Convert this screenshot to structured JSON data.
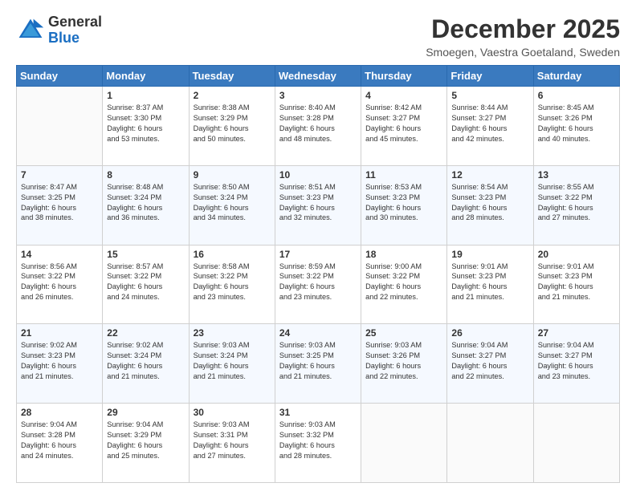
{
  "header": {
    "logo_line1": "General",
    "logo_line2": "Blue",
    "title": "December 2025",
    "subtitle": "Smoegen, Vaestra Goetaland, Sweden"
  },
  "days_of_week": [
    "Sunday",
    "Monday",
    "Tuesday",
    "Wednesday",
    "Thursday",
    "Friday",
    "Saturday"
  ],
  "weeks": [
    [
      {
        "day": "",
        "info": ""
      },
      {
        "day": "1",
        "info": "Sunrise: 8:37 AM\nSunset: 3:30 PM\nDaylight: 6 hours\nand 53 minutes."
      },
      {
        "day": "2",
        "info": "Sunrise: 8:38 AM\nSunset: 3:29 PM\nDaylight: 6 hours\nand 50 minutes."
      },
      {
        "day": "3",
        "info": "Sunrise: 8:40 AM\nSunset: 3:28 PM\nDaylight: 6 hours\nand 48 minutes."
      },
      {
        "day": "4",
        "info": "Sunrise: 8:42 AM\nSunset: 3:27 PM\nDaylight: 6 hours\nand 45 minutes."
      },
      {
        "day": "5",
        "info": "Sunrise: 8:44 AM\nSunset: 3:27 PM\nDaylight: 6 hours\nand 42 minutes."
      },
      {
        "day": "6",
        "info": "Sunrise: 8:45 AM\nSunset: 3:26 PM\nDaylight: 6 hours\nand 40 minutes."
      }
    ],
    [
      {
        "day": "7",
        "info": "Sunrise: 8:47 AM\nSunset: 3:25 PM\nDaylight: 6 hours\nand 38 minutes."
      },
      {
        "day": "8",
        "info": "Sunrise: 8:48 AM\nSunset: 3:24 PM\nDaylight: 6 hours\nand 36 minutes."
      },
      {
        "day": "9",
        "info": "Sunrise: 8:50 AM\nSunset: 3:24 PM\nDaylight: 6 hours\nand 34 minutes."
      },
      {
        "day": "10",
        "info": "Sunrise: 8:51 AM\nSunset: 3:23 PM\nDaylight: 6 hours\nand 32 minutes."
      },
      {
        "day": "11",
        "info": "Sunrise: 8:53 AM\nSunset: 3:23 PM\nDaylight: 6 hours\nand 30 minutes."
      },
      {
        "day": "12",
        "info": "Sunrise: 8:54 AM\nSunset: 3:23 PM\nDaylight: 6 hours\nand 28 minutes."
      },
      {
        "day": "13",
        "info": "Sunrise: 8:55 AM\nSunset: 3:22 PM\nDaylight: 6 hours\nand 27 minutes."
      }
    ],
    [
      {
        "day": "14",
        "info": "Sunrise: 8:56 AM\nSunset: 3:22 PM\nDaylight: 6 hours\nand 26 minutes."
      },
      {
        "day": "15",
        "info": "Sunrise: 8:57 AM\nSunset: 3:22 PM\nDaylight: 6 hours\nand 24 minutes."
      },
      {
        "day": "16",
        "info": "Sunrise: 8:58 AM\nSunset: 3:22 PM\nDaylight: 6 hours\nand 23 minutes."
      },
      {
        "day": "17",
        "info": "Sunrise: 8:59 AM\nSunset: 3:22 PM\nDaylight: 6 hours\nand 23 minutes."
      },
      {
        "day": "18",
        "info": "Sunrise: 9:00 AM\nSunset: 3:22 PM\nDaylight: 6 hours\nand 22 minutes."
      },
      {
        "day": "19",
        "info": "Sunrise: 9:01 AM\nSunset: 3:23 PM\nDaylight: 6 hours\nand 21 minutes."
      },
      {
        "day": "20",
        "info": "Sunrise: 9:01 AM\nSunset: 3:23 PM\nDaylight: 6 hours\nand 21 minutes."
      }
    ],
    [
      {
        "day": "21",
        "info": "Sunrise: 9:02 AM\nSunset: 3:23 PM\nDaylight: 6 hours\nand 21 minutes."
      },
      {
        "day": "22",
        "info": "Sunrise: 9:02 AM\nSunset: 3:24 PM\nDaylight: 6 hours\nand 21 minutes."
      },
      {
        "day": "23",
        "info": "Sunrise: 9:03 AM\nSunset: 3:24 PM\nDaylight: 6 hours\nand 21 minutes."
      },
      {
        "day": "24",
        "info": "Sunrise: 9:03 AM\nSunset: 3:25 PM\nDaylight: 6 hours\nand 21 minutes."
      },
      {
        "day": "25",
        "info": "Sunrise: 9:03 AM\nSunset: 3:26 PM\nDaylight: 6 hours\nand 22 minutes."
      },
      {
        "day": "26",
        "info": "Sunrise: 9:04 AM\nSunset: 3:27 PM\nDaylight: 6 hours\nand 22 minutes."
      },
      {
        "day": "27",
        "info": "Sunrise: 9:04 AM\nSunset: 3:27 PM\nDaylight: 6 hours\nand 23 minutes."
      }
    ],
    [
      {
        "day": "28",
        "info": "Sunrise: 9:04 AM\nSunset: 3:28 PM\nDaylight: 6 hours\nand 24 minutes."
      },
      {
        "day": "29",
        "info": "Sunrise: 9:04 AM\nSunset: 3:29 PM\nDaylight: 6 hours\nand 25 minutes."
      },
      {
        "day": "30",
        "info": "Sunrise: 9:03 AM\nSunset: 3:31 PM\nDaylight: 6 hours\nand 27 minutes."
      },
      {
        "day": "31",
        "info": "Sunrise: 9:03 AM\nSunset: 3:32 PM\nDaylight: 6 hours\nand 28 minutes."
      },
      {
        "day": "",
        "info": ""
      },
      {
        "day": "",
        "info": ""
      },
      {
        "day": "",
        "info": ""
      }
    ]
  ]
}
